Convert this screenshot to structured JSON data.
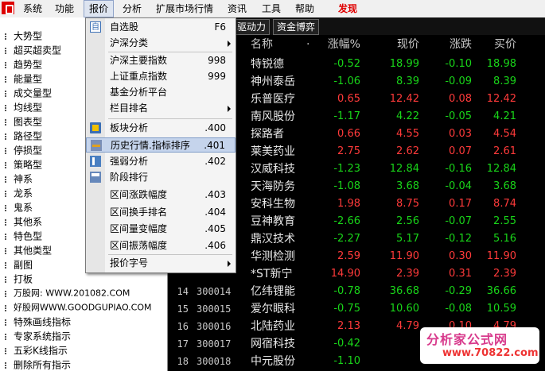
{
  "menubar": {
    "items": [
      {
        "label": "系统"
      },
      {
        "label": "功能"
      },
      {
        "label": "报价"
      },
      {
        "label": "分析"
      },
      {
        "label": "扩展市场行情"
      },
      {
        "label": "资讯"
      },
      {
        "label": "工具"
      },
      {
        "label": "帮助"
      },
      {
        "label": "发现"
      }
    ]
  },
  "sidebar": {
    "items": [
      {
        "label": "大势型"
      },
      {
        "label": "超买超卖型"
      },
      {
        "label": "趋势型"
      },
      {
        "label": "能量型"
      },
      {
        "label": "成交量型"
      },
      {
        "label": "均线型"
      },
      {
        "label": "图表型"
      },
      {
        "label": "路径型"
      },
      {
        "label": "停损型"
      },
      {
        "label": "策略型"
      },
      {
        "label": "神系"
      },
      {
        "label": "龙系"
      },
      {
        "label": "鬼系"
      },
      {
        "label": "其他系"
      },
      {
        "label": "特色型"
      },
      {
        "label": "其他类型"
      },
      {
        "label": "副图"
      },
      {
        "label": "打板"
      },
      {
        "label": "万股网: WWW.201082.COM"
      },
      {
        "label": "好股网WWW.GOODGUPIAO.COM"
      },
      {
        "label": "特殊画线指标"
      },
      {
        "label": "专家系统指示"
      },
      {
        "label": "五彩K线指示"
      },
      {
        "label": "删除所有指示"
      }
    ]
  },
  "tabs": [
    {
      "label": "驱动力"
    },
    {
      "label": "资金博弈"
    }
  ],
  "table": {
    "headers": {
      "name": "名称",
      "dot": "·",
      "change_pct": "涨幅%",
      "price": "现价",
      "change": "涨跌",
      "bid": "买价"
    },
    "rows": [
      {
        "num": "",
        "code": "",
        "name": "特锐德",
        "pct": "-0.52",
        "price": "18.99",
        "chg": "-0.10",
        "bid": "18.98",
        "dir": "down"
      },
      {
        "num": "",
        "code": "",
        "name": "神州泰岳",
        "pct": "-1.06",
        "price": "8.39",
        "chg": "-0.09",
        "bid": "8.39",
        "dir": "down"
      },
      {
        "num": "",
        "code": "",
        "name": "乐普医疗",
        "pct": "0.65",
        "price": "12.42",
        "chg": "0.08",
        "bid": "12.42",
        "dir": "up"
      },
      {
        "num": "",
        "code": "",
        "name": "南风股份",
        "pct": "-1.17",
        "price": "4.22",
        "chg": "-0.05",
        "bid": "4.21",
        "dir": "down"
      },
      {
        "num": "",
        "code": "",
        "name": "探路者",
        "pct": "0.66",
        "price": "4.55",
        "chg": "0.03",
        "bid": "4.54",
        "dir": "up"
      },
      {
        "num": "",
        "code": "",
        "name": "莱美药业",
        "pct": "2.75",
        "price": "2.62",
        "chg": "0.07",
        "bid": "2.61",
        "dir": "up"
      },
      {
        "num": "",
        "code": "",
        "name": "汉威科技",
        "pct": "-1.23",
        "price": "12.84",
        "chg": "-0.16",
        "bid": "12.84",
        "dir": "down"
      },
      {
        "num": "",
        "code": "",
        "name": "天海防务",
        "pct": "-1.08",
        "price": "3.68",
        "chg": "-0.04",
        "bid": "3.68",
        "dir": "down"
      },
      {
        "num": "",
        "code": "",
        "name": "安科生物",
        "pct": "1.98",
        "price": "8.75",
        "chg": "0.17",
        "bid": "8.74",
        "dir": "up"
      },
      {
        "num": "",
        "code": "",
        "name": "豆神教育",
        "pct": "-2.66",
        "price": "2.56",
        "chg": "-0.07",
        "bid": "2.55",
        "dir": "down"
      },
      {
        "num": "",
        "code": "",
        "name": "鼎汉技术",
        "pct": "-2.27",
        "price": "5.17",
        "chg": "-0.12",
        "bid": "5.16",
        "dir": "down"
      },
      {
        "num": "",
        "code": "",
        "name": "华测检测",
        "pct": "2.59",
        "price": "11.90",
        "chg": "0.30",
        "bid": "11.90",
        "dir": "up"
      },
      {
        "num": "",
        "code": "",
        "name": "*ST新宁",
        "pct": "14.90",
        "price": "2.39",
        "chg": "0.31",
        "bid": "2.39",
        "dir": "up"
      },
      {
        "num": "14",
        "code": "300014",
        "name": "亿纬锂能",
        "pct": "-0.78",
        "price": "36.68",
        "chg": "-0.29",
        "bid": "36.66",
        "dir": "down"
      },
      {
        "num": "15",
        "code": "300015",
        "name": "爱尔眼科",
        "pct": "-0.75",
        "price": "10.60",
        "chg": "-0.08",
        "bid": "10.59",
        "dir": "down"
      },
      {
        "num": "16",
        "code": "300016",
        "name": "北陆药业",
        "pct": "2.13",
        "price": "4.79",
        "chg": "0.10",
        "bid": "4.79",
        "dir": "up"
      },
      {
        "num": "17",
        "code": "300017",
        "name": "网宿科技",
        "pct": "-0.42",
        "price": "",
        "chg": "",
        "bid": "",
        "dir": "down"
      },
      {
        "num": "18",
        "code": "300018",
        "name": "中元股份",
        "pct": "-1.10",
        "price": "",
        "chg": "",
        "bid": "",
        "dir": "down"
      }
    ]
  },
  "dropdown": {
    "items": [
      {
        "label": "自选股",
        "shortcut": "F6",
        "icon": "selfselect-icon"
      },
      {
        "label": "沪深分类",
        "submenu": true
      },
      {
        "label": "沪深主要指数",
        "shortcut": "998"
      },
      {
        "label": "上证重点指数",
        "shortcut": "999"
      },
      {
        "label": "基金分析平台"
      },
      {
        "label": "栏目排名",
        "submenu": true
      },
      {
        "label": "板块分析",
        "shortcut": ".400",
        "icon": "board-icon"
      },
      {
        "label": "历史行情.指标排序",
        "shortcut": ".401",
        "icon": "history-icon"
      },
      {
        "label": "强弱分析",
        "shortcut": ".402",
        "icon": "strength-icon"
      },
      {
        "label": "阶段排行",
        "icon": "stage-icon"
      },
      {
        "label": "区间涨跌幅度",
        "shortcut": ".403"
      },
      {
        "label": "区间换手排名",
        "shortcut": ".404"
      },
      {
        "label": "区间量变幅度",
        "shortcut": ".405"
      },
      {
        "label": "区间振荡幅度",
        "shortcut": ".406"
      },
      {
        "label": "报价字号",
        "submenu": true
      }
    ]
  },
  "watermark": {
    "title": "分析家公式网",
    "url": "www.70822.com"
  },
  "colors": {
    "up": "#ff3a3a",
    "down": "#19d519",
    "highlight": "#c5d4ec",
    "menu_active": "#dde4f0"
  }
}
